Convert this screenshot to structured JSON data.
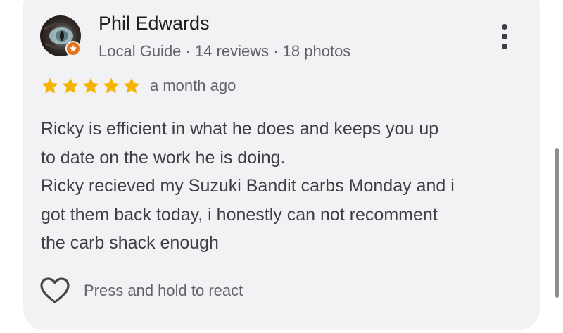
{
  "review": {
    "author": {
      "name": "Phil Edwards",
      "meta": "Local Guide · 14 reviews · 18 photos"
    },
    "rating": {
      "stars": 5,
      "max": 5,
      "star_color": "#f4b400"
    },
    "time": "a month ago",
    "text_lines": [
      "Ricky is efficient in what he does and keeps you up",
      "to date on the work he is doing.",
      "Ricky recieved my Suzuki Bandit carbs Monday and i",
      "got them back today, i honestly can not recomment",
      "the carb shack enough"
    ],
    "react_label": "Press and hold to react"
  },
  "icons": {
    "more": "more-vert-icon",
    "heart": "heart-outline-icon",
    "badge": "local-guide-badge-icon"
  },
  "colors": {
    "card_background": "#f2f2f4",
    "badge": "#e8711c"
  }
}
